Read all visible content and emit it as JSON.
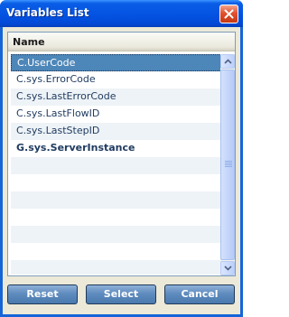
{
  "window": {
    "title": "Variables List",
    "close_icon": "close-x"
  },
  "list": {
    "header": "Name",
    "rows": [
      {
        "name": "C.UserCode"
      },
      {
        "name": "C.sys.ErrorCode"
      },
      {
        "name": "C.sys.LastErrorCode"
      },
      {
        "name": "C.sys.LastFlowID"
      },
      {
        "name": "C.sys.LastStepID"
      },
      {
        "name": "G.sys.ServerInstance"
      }
    ],
    "selected_index": 0
  },
  "buttons": {
    "reset": "Reset",
    "select": "Select",
    "cancel": "Cancel"
  },
  "colors": {
    "accent": "#0554e3",
    "selection": "#4d86b8",
    "button": "#5f8cbf"
  }
}
